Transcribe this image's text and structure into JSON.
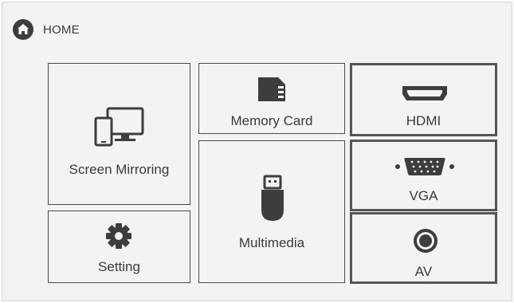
{
  "header": {
    "title": "HOME",
    "icon": "home-icon"
  },
  "tiles": {
    "screen_mirroring": {
      "label": "Screen Mirroring",
      "icon": "screen-mirroring-icon"
    },
    "setting": {
      "label": "Setting",
      "icon": "gear-icon"
    },
    "memory_card": {
      "label": "Memory Card",
      "icon": "sd-card-icon"
    },
    "multimedia": {
      "label": "Multimedia",
      "icon": "usb-drive-icon"
    },
    "hdmi": {
      "label": "HDMI",
      "icon": "hdmi-port-icon"
    },
    "vga": {
      "label": "VGA",
      "icon": "vga-port-icon"
    },
    "av": {
      "label": "AV",
      "icon": "av-port-icon"
    }
  },
  "colors": {
    "background": "#f3f3f3",
    "icon": "#3d3d3d",
    "border": "#4a4a4a"
  }
}
